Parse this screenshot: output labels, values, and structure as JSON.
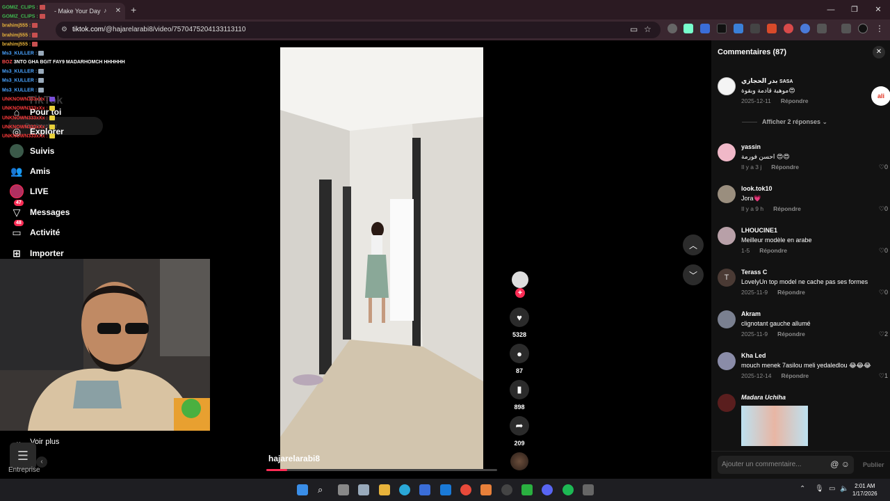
{
  "browser": {
    "tab_title": "- Make Your Day",
    "url_host": "tiktok.com",
    "url_path": "/@hajarelarabi8/video/7570475204133113110"
  },
  "chat": [
    {
      "user": "GOMIZ_CLIPS",
      "color": "#3fb950"
    },
    {
      "user": "GOMIZ_CLIPS",
      "color": "#3fb950"
    },
    {
      "user": "brahimj555",
      "color": "#e8b33b"
    },
    {
      "user": "brahimj555",
      "color": "#e8b33b"
    },
    {
      "user": "brahimj555",
      "color": "#e8b33b"
    },
    {
      "user": "Ms3_KULLER",
      "color": "#4aa3ff"
    },
    {
      "user": "BOZ",
      "color": "#ff4b4b",
      "text": "3NTO GHA BGIT FAY9 MADARHOMCH HHHHHH"
    },
    {
      "user": "Ms3_KULLER",
      "color": "#4aa3ff"
    },
    {
      "user": "Ms3_KULLER",
      "color": "#4aa3ff"
    },
    {
      "user": "Ms3_KULLER",
      "color": "#4aa3ff"
    },
    {
      "user": "UNKNOWN333xXx",
      "color": "#ff3b3b"
    },
    {
      "user": "UNKNOWN333xXx",
      "color": "#ff3b3b"
    },
    {
      "user": "UNKNOWN333xXx",
      "color": "#ff3b3b"
    },
    {
      "user": "UNKNOWN333xXx",
      "color": "#ff3b3b"
    },
    {
      "user": "UNKNOWN333xXx",
      "color": "#ff3b3b"
    }
  ],
  "sidebar": {
    "logo": "TikTok",
    "search_placeholder": "Rechercher",
    "items": [
      {
        "label": "Pour toi",
        "icon": "home-icon"
      },
      {
        "label": "Explorer",
        "icon": "compass-icon"
      },
      {
        "label": "Suivis",
        "icon": "following-icon"
      },
      {
        "label": "Amis",
        "icon": "friends-icon"
      },
      {
        "label": "LIVE",
        "icon": "live-icon"
      },
      {
        "label": "Messages",
        "icon": "messages-icon",
        "badge": "47"
      },
      {
        "label": "Activité",
        "icon": "activity-icon",
        "badge": "48"
      },
      {
        "label": "Importer",
        "icon": "upload-icon"
      }
    ],
    "more": "Voir plus",
    "footer": "Entreprise"
  },
  "video": {
    "author": "hajarelarabi8",
    "progress": 0.09,
    "likes": "5328",
    "comments": "87",
    "saves": "898",
    "shares": "209"
  },
  "comments_panel": {
    "title": "Commentaires (87)",
    "show_replies": "Afficher 2 réponses",
    "reply_label": "Répondre",
    "input_placeholder": "Ajouter un commentaire...",
    "publish_label": "Publier",
    "items": [
      {
        "user": "بدر الحجازي",
        "user_tag": "SASA",
        "text": "موهبة قادمة وبقوة😍",
        "date": "2025-12-11",
        "likes": "",
        "avatar_color": "#f4f4f4"
      },
      {
        "user": "yassin",
        "text": "احسن فورمة 😍😍",
        "date": "Il y a 3 j",
        "likes": "0",
        "avatar_color": "#f0b8c8"
      },
      {
        "user": "look.tok10",
        "text": "Jora💗",
        "date": "Il y a 9 h",
        "likes": "0",
        "avatar_color": "#9a8e7e"
      },
      {
        "user": "LHOUCINE1",
        "text": "Meilleur modèle en arabe",
        "date": "1-5",
        "likes": "0",
        "avatar_color": "#b8a0a8"
      },
      {
        "user": "Terass C",
        "text": "LovelyUn top model ne cache pas ses formes",
        "date": "2025-11-9",
        "likes": "0",
        "avatar_color": "#4a3a34",
        "initial": "T"
      },
      {
        "user": "Akram",
        "text": "clignotant gauche allumé",
        "date": "2025-11-9",
        "likes": "2",
        "avatar_color": "#7a8090"
      },
      {
        "user": "Kha Led",
        "text": "mouch menek 7asilou meli yedaledlou 😂😂😂",
        "date": "2025-12-14",
        "likes": "1",
        "avatar_color": "#8a8ca8"
      },
      {
        "user": "Madara Uchiha",
        "text": "",
        "date": "",
        "likes": "",
        "avatar_color": "#5a1e1e"
      }
    ]
  },
  "taskbar": {
    "time": "2:01 AM",
    "date": "1/17/2026"
  }
}
